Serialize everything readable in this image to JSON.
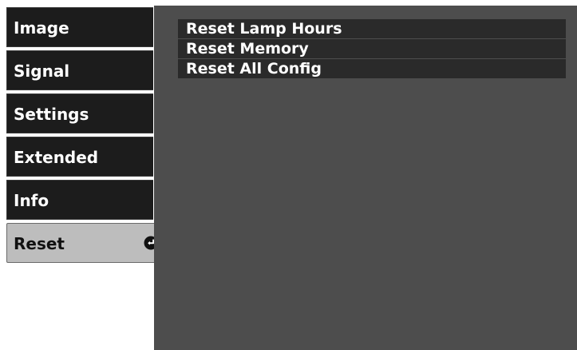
{
  "sidebar": {
    "items": [
      {
        "label": "Image"
      },
      {
        "label": "Signal"
      },
      {
        "label": "Settings"
      },
      {
        "label": "Extended"
      },
      {
        "label": "Info"
      },
      {
        "label": "Reset",
        "icon": "enter-icon",
        "selected": true
      }
    ]
  },
  "main": {
    "options": [
      {
        "label": "Reset Lamp Hours"
      },
      {
        "label": "Reset Memory"
      },
      {
        "label": "Reset All Config"
      }
    ]
  },
  "colors": {
    "sidebar_bg": "#1c1c1c",
    "sidebar_active_bg": "#bdbdbd",
    "panel_bg": "#4d4d4d",
    "option_bg": "#2a2a2a",
    "text_light": "#ffffff",
    "text_dark": "#111111"
  }
}
